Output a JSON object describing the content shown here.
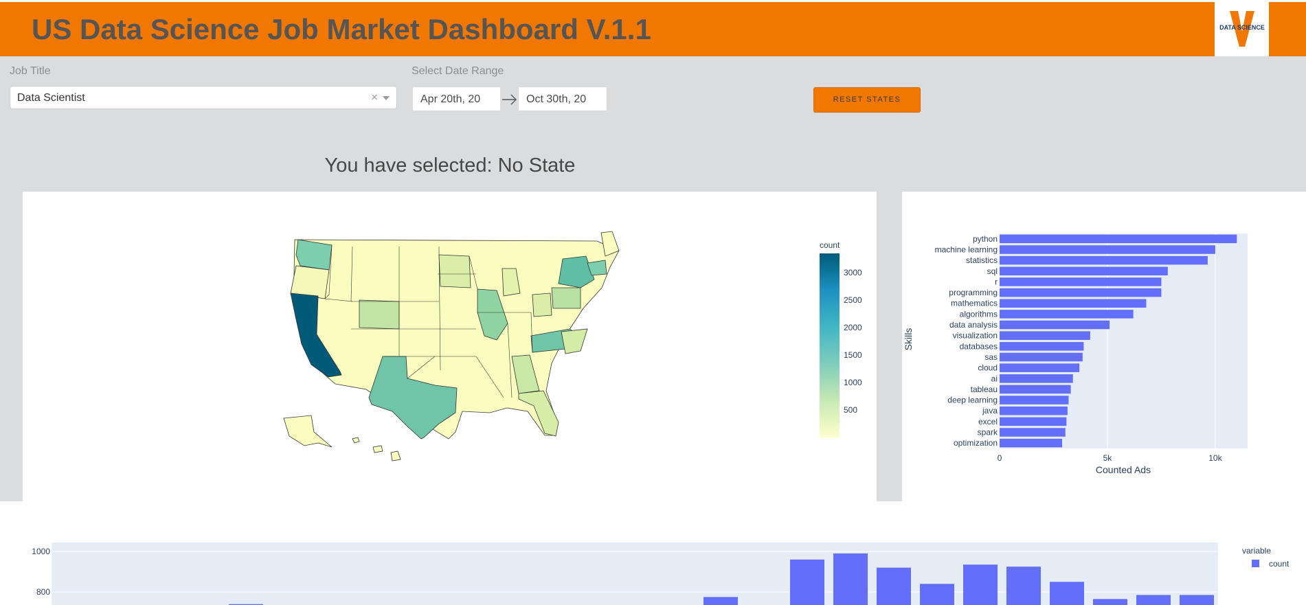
{
  "header": {
    "title": "US Data Science Job Market Dashboard V.1.1",
    "logo_text": "DATA SCIENCE",
    "brand_color": "#f07700"
  },
  "filters": {
    "job_title_label": "Job Title",
    "job_title_value": "Data Scientist",
    "clear_glyph": "×",
    "date_range_label": "Select Date Range",
    "start_date": "Apr 20th, 20",
    "end_date": "Oct 30th, 20",
    "reset_label": "RESET STATES"
  },
  "selection_text": "You have selected: No State",
  "map": {
    "colorbar_title": "count",
    "colorbar_ticks": [
      "3000",
      "2500",
      "2000",
      "1500",
      "1000",
      "500"
    ],
    "colorscale": [
      "#ffffcc",
      "#c7e9b4",
      "#7fcdbb",
      "#41b6c4",
      "#1d91c0",
      "#005a78"
    ]
  },
  "chart_data": [
    {
      "type": "bar",
      "orientation": "horizontal",
      "categories": [
        "python",
        "machine learning",
        "statistics",
        "sql",
        "r",
        "programming",
        "mathematics",
        "algorithms",
        "data analysis",
        "visualization",
        "databases",
        "sas",
        "cloud",
        "ai",
        "tableau",
        "deep learning",
        "java",
        "excel",
        "spark",
        "optimization"
      ],
      "values": [
        11000,
        10000,
        9650,
        7800,
        7500,
        7500,
        6800,
        6200,
        5100,
        4200,
        3900,
        3850,
        3700,
        3400,
        3300,
        3200,
        3150,
        3100,
        3050,
        2900
      ],
      "xlabel": "Counted Ads",
      "ylabel": "Skills",
      "xticks": [
        "0",
        "5k",
        "10k"
      ],
      "xlim": [
        0,
        11500
      ],
      "bar_color": "#636efa"
    },
    {
      "type": "bar",
      "y_visible_range": [
        720,
        1000
      ],
      "yticks": [
        "1000",
        "800"
      ],
      "values": [
        740,
        725,
        775,
        720,
        960,
        990,
        920,
        840,
        935,
        925,
        850,
        765,
        785,
        785,
        780
      ],
      "legend_title": "variable",
      "series": [
        {
          "name": "count"
        }
      ],
      "bar_color": "#636efa"
    }
  ]
}
